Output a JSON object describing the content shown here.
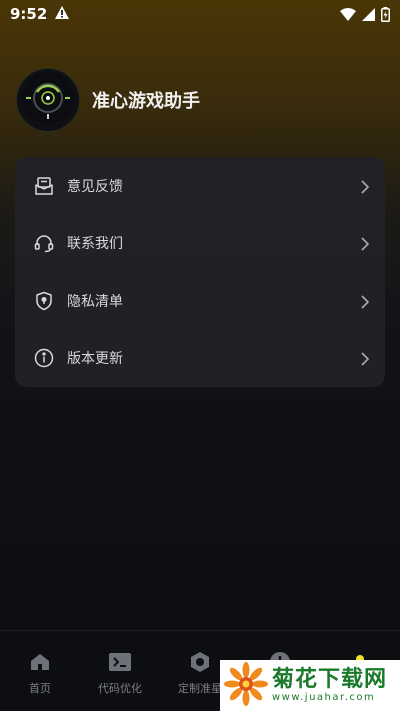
{
  "status_bar": {
    "time": "9:52",
    "icons": [
      "alert-icon",
      "wifi-icon",
      "signal-icon",
      "battery-icon"
    ]
  },
  "profile": {
    "app_name": "准心游戏助手",
    "avatar_icon": "crosshair-icon"
  },
  "menu": {
    "items": [
      {
        "label": "意见反馈",
        "icon": "feedback-mail-icon"
      },
      {
        "label": "联系我们",
        "icon": "headset-icon"
      },
      {
        "label": "隐私清单",
        "icon": "shield-lock-icon"
      },
      {
        "label": "版本更新",
        "icon": "info-icon"
      }
    ]
  },
  "bottom_nav": {
    "items": [
      {
        "label": "首页",
        "icon": "home-icon"
      },
      {
        "label": "代码优化",
        "icon": "terminal-icon"
      },
      {
        "label": "定制准星",
        "icon": "hexagon-icon"
      },
      {
        "label": "",
        "icon": "plus-circle-icon"
      },
      {
        "label": "",
        "icon": "profile-icon",
        "active": true
      }
    ]
  },
  "watermark": {
    "title": "菊花下载网",
    "url": "www.juahar.com"
  },
  "colors": {
    "accent": "#f2e028",
    "avatar_ring": "#9ad04a",
    "card_bg": "#222328"
  }
}
